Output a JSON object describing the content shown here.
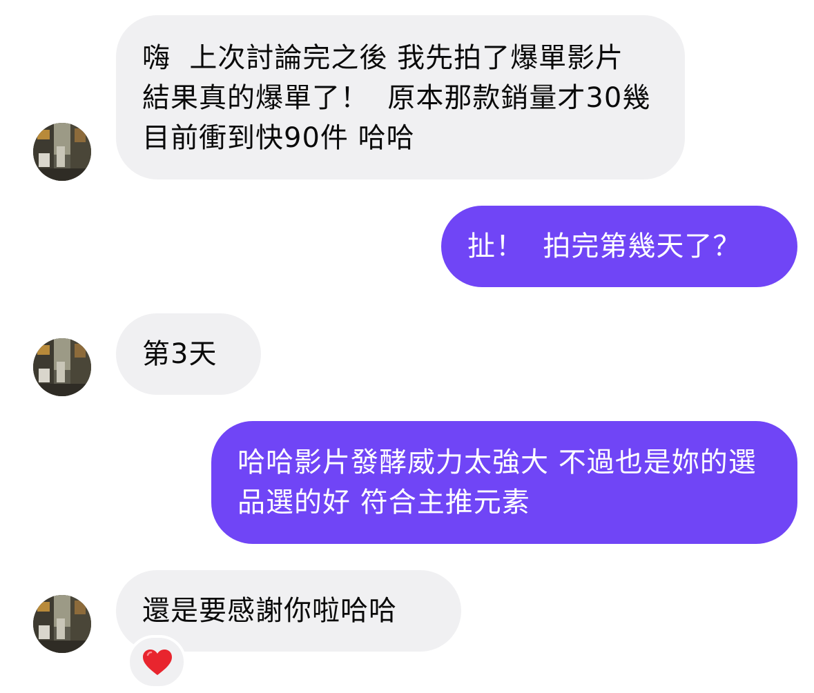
{
  "conversation": {
    "messages": [
      {
        "direction": "incoming",
        "text": "嗨  上次討論完之後 我先拍了爆單影片 結果真的爆單了！  原本那款銷量才30幾 目前衝到快90件 哈哈"
      },
      {
        "direction": "outgoing",
        "text": "扯！  拍完第幾天了？"
      },
      {
        "direction": "incoming",
        "text": "第3天"
      },
      {
        "direction": "outgoing",
        "text": "哈哈影片發酵威力太強大 不過也是妳的選品選的好 符合主推元素"
      },
      {
        "direction": "incoming",
        "text": "還是要感謝你啦哈哈"
      }
    ],
    "reaction": {
      "icon": "heart-icon",
      "color": "#e8252e"
    }
  },
  "colors": {
    "incoming_bubble": "#f0f0f2",
    "outgoing_bubble": "#7045f6",
    "incoming_text": "#0a0a0a",
    "outgoing_text": "#ffffff"
  }
}
